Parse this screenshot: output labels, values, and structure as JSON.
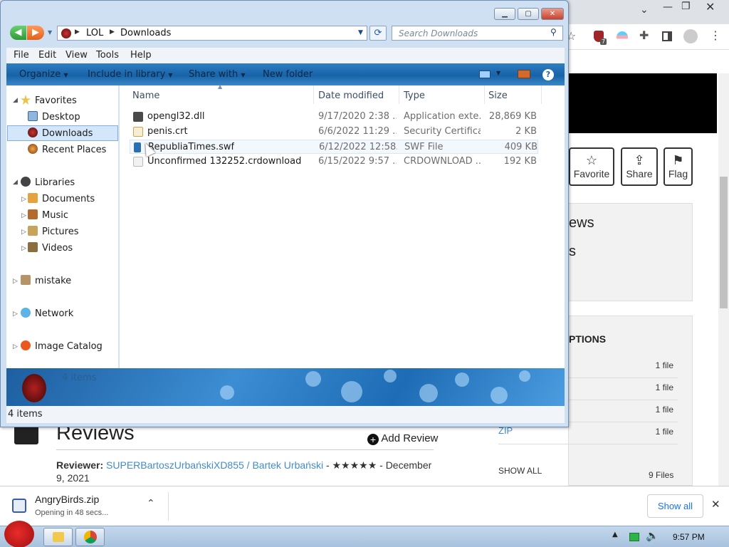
{
  "browser": {
    "extension_badge": "7",
    "actions": [
      {
        "label": "Favorite",
        "icon": "star-icon"
      },
      {
        "label": "Share",
        "icon": "share-icon"
      },
      {
        "label": "Flag",
        "icon": "flag-icon"
      }
    ],
    "panel1": {
      "line1": "ews",
      "line2": "s"
    },
    "panel2": {
      "heading": "PTIONS",
      "rows": [
        {
          "label": "",
          "count": "1 file"
        },
        {
          "label": "",
          "count": "1 file"
        },
        {
          "label": "",
          "count": "1 file"
        },
        {
          "label": "ZIP",
          "count": "1 file"
        }
      ],
      "show_all": "SHOW ALL",
      "show_all_count": "9 Files"
    },
    "reviews": {
      "title": "Reviews",
      "add_review": "Add Review",
      "reviewer_label": "Reviewer:",
      "reviewer_name": "SUPERBartoszUrbańskiXD855 / Bartek Urbański",
      "rating_and_date": " - ★★★★★ - December 9, 2021"
    }
  },
  "download_bar": {
    "filename": "AngryBirds.zip",
    "status": "Opening in 48 secs...",
    "show_all": "Show all"
  },
  "taskbar": {
    "time": "9:57 PM"
  },
  "explorer": {
    "breadcrumb": [
      "LOL",
      "Downloads"
    ],
    "search_placeholder": "Search Downloads",
    "menu": [
      "File",
      "Edit",
      "View",
      "Tools",
      "Help"
    ],
    "commands": {
      "organize": "Organize",
      "include": "Include in library",
      "share": "Share with",
      "new_folder": "New folder"
    },
    "nav": {
      "favorites": "Favorites",
      "desktop": "Desktop",
      "downloads": "Downloads",
      "recent": "Recent Places",
      "libraries": "Libraries",
      "documents": "Documents",
      "music": "Music",
      "pictures": "Pictures",
      "videos": "Videos",
      "mistake": "mistake",
      "network": "Network",
      "image_catalog": "Image Catalog"
    },
    "columns": {
      "name": "Name",
      "date": "Date modified",
      "type": "Type",
      "size": "Size"
    },
    "files": [
      {
        "name": "opengl32.dll",
        "date": "9/17/2020 2:38 ...",
        "type": "Application exte...",
        "size": "28,869 KB",
        "icon": "dll-file-icon",
        "color": "#4a4a4a"
      },
      {
        "name": "penis.crt",
        "date": "6/6/2022 11:29 ...",
        "type": "Security Certifica...",
        "size": "2 KB",
        "icon": "certificate-file-icon",
        "color": "#c9a64a"
      },
      {
        "name": "RepubliaTimes.swf",
        "date": "6/12/2022 12:58...",
        "type": "SWF File",
        "size": "409 KB",
        "icon": "swf-file-icon",
        "color": "#2a6fb3"
      },
      {
        "name": "Unconfirmed 132252.crdownload",
        "date": "6/15/2022 9:57 ...",
        "type": "CRDOWNLOAD ...",
        "size": "192 KB",
        "icon": "crdownload-file-icon",
        "color": "#e8e8e8"
      }
    ],
    "detail_items": "4 items",
    "status_items": "4 items"
  }
}
